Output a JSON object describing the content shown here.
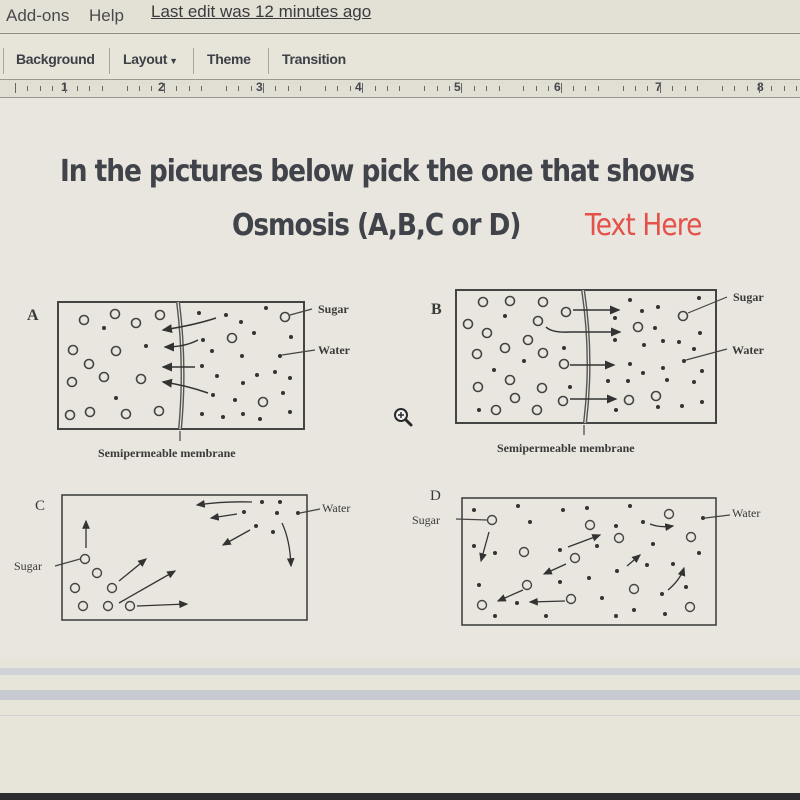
{
  "menubar": {
    "items": [
      "Add-ons",
      "Help"
    ],
    "last_edit": "Last edit was 12 minutes ago"
  },
  "toolbar": {
    "background_label": "Background",
    "layout_label": "Layout",
    "theme_label": "Theme",
    "transition_label": "Transition"
  },
  "ruler": {
    "numbers": [
      "1",
      "2",
      "3",
      "4",
      "5",
      "6",
      "7",
      "8"
    ]
  },
  "slide": {
    "question_line1": "In the pictures below pick the one that shows",
    "question_line2": "Osmosis (A,B,C or D)",
    "answer_placeholder": "Text Here",
    "answer_color": "#e3514a"
  },
  "diagrams": {
    "a": {
      "letter": "A",
      "sugar_label": "Sugar",
      "water_label": "Water",
      "membrane_label": "Semipermeable membrane"
    },
    "b": {
      "letter": "B",
      "sugar_label": "Sugar",
      "water_label": "Water",
      "membrane_label": "Semipermeable membrane"
    },
    "c": {
      "letter": "C",
      "sugar_label": "Sugar",
      "water_label": "Water"
    },
    "d": {
      "letter": "D",
      "sugar_label": "Sugar",
      "water_label": "Water"
    }
  },
  "cursor": {
    "icon": "zoom-in-icon"
  }
}
